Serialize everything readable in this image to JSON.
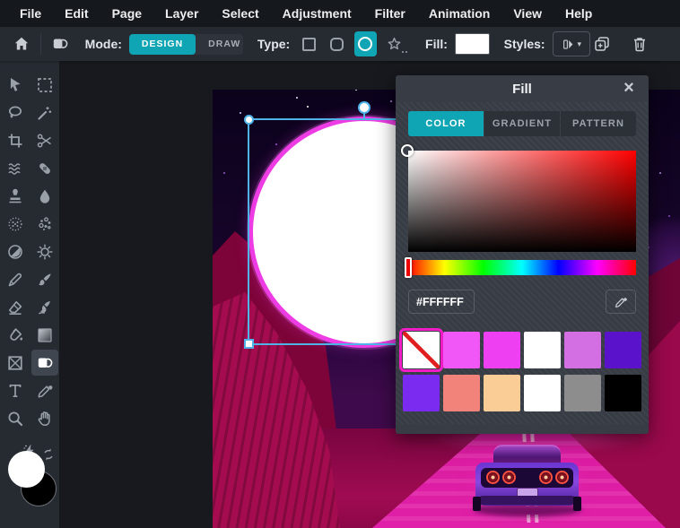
{
  "menu_bar": {
    "items": [
      "File",
      "Edit",
      "Page",
      "Layer",
      "Select",
      "Adjustment",
      "Filter",
      "Animation",
      "View",
      "Help"
    ]
  },
  "topbar": {
    "mode_label": "Mode:",
    "mode_options": [
      {
        "label": "DESIGN",
        "active": true
      },
      {
        "label": "DRAW",
        "active": false
      }
    ],
    "type_label": "Type:",
    "type_options": [
      "square",
      "rounded-square",
      "circle",
      "star"
    ],
    "type_selected": "circle",
    "fill_label": "Fill:",
    "fill_value": "#FFFFFF",
    "styles_label": "Styles:"
  },
  "tool_sidebar": {
    "tools": [
      "select-arrow",
      "marquee",
      "lasso",
      "magic-wand",
      "crop",
      "scissors",
      "liquify",
      "heal",
      "clone-stamp",
      "droplet",
      "pixelate",
      "particles",
      "contrast",
      "sun-adjust",
      "pen",
      "brush",
      "eraser",
      "smudge",
      "fill-bucket",
      "gradient",
      "frame",
      "shape",
      "text",
      "eyedropper",
      "zoom",
      "hand",
      "auto-enhance"
    ],
    "active_tool": "shape",
    "foreground_color": "#FFFFFF",
    "background_color": "#000000"
  },
  "fill_panel": {
    "title": "Fill",
    "close_glyph": "×",
    "tabs": [
      {
        "label": "COLOR",
        "active": true
      },
      {
        "label": "GRADIENT",
        "active": false
      },
      {
        "label": "PATTERN",
        "active": false
      }
    ],
    "hex_value": "#FFFFFF",
    "picker": {
      "selected_color": "#FFFFFF",
      "hue_position": 0
    },
    "swatches": [
      {
        "value": "none",
        "selected": true
      },
      {
        "value": "#F156F7"
      },
      {
        "value": "#EE3FF2"
      },
      {
        "value": "#FFFFFF"
      },
      {
        "value": "#D36FE2"
      },
      {
        "value": "#5A13CB"
      },
      {
        "value": "#7A2BEF"
      },
      {
        "value": "#F2837B"
      },
      {
        "value": "#FACD96"
      },
      {
        "value": "#FFFFFF"
      },
      {
        "value": "#8D8D8D"
      },
      {
        "value": "#000000"
      }
    ]
  },
  "canvas": {
    "selected_shape": {
      "type": "ellipse",
      "fill": "#FFFFFF",
      "stroke": "#EE3CE4"
    }
  },
  "colors": {
    "accent_teal": "#10A5B4",
    "swatch_selected_border": "#F21CC6",
    "selection_box_blue": "#4FB3E8",
    "menubar_bg": "#15181C",
    "toolbar_bg": "#262B32",
    "panel_bg": "#383D45"
  }
}
